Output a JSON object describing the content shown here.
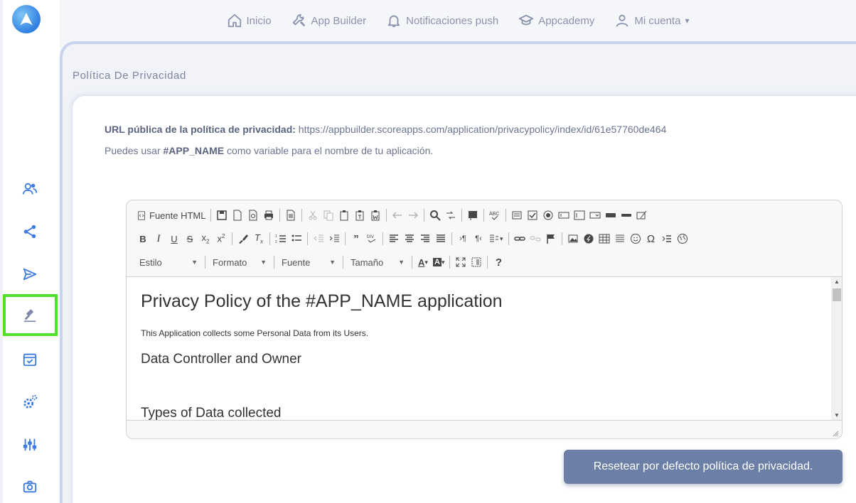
{
  "nav": {
    "items": [
      {
        "label": "Inicio",
        "icon": "home-icon"
      },
      {
        "label": "App Builder",
        "icon": "wrench-icon"
      },
      {
        "label": "Notificaciones push",
        "icon": "bell-icon"
      },
      {
        "label": "Appcademy",
        "icon": "graduation-cap-icon"
      },
      {
        "label": "Mi cuenta",
        "icon": "user-icon"
      }
    ],
    "account_caret": "▾"
  },
  "sidebar": {
    "icons": [
      "users-icon",
      "share-icon",
      "send-icon",
      "gavel-icon",
      "calendar-check-icon",
      "gears-icon",
      "sliders-icon",
      "camera-icon"
    ],
    "active": "gavel-icon"
  },
  "page": {
    "title": "Política De Privacidad",
    "url_label": "URL pública de la política de privacidad:",
    "url_value": " https://appbuilder.scoreapps.com/application/privacypolicy/index/id/61e57760de464",
    "var_prefix": "Puedes usar ",
    "var_name": "#APP_NAME",
    "var_suffix": " como variable para el nombre de tu aplicación."
  },
  "editor": {
    "source_label": "Fuente HTML",
    "combos": {
      "style": "Estilo",
      "format": "Formato",
      "font": "Fuente",
      "size": "Tamaño"
    },
    "content": {
      "h1": "Privacy Policy of the #APP_NAME application",
      "p1": "This Application collects some Personal Data from its Users.",
      "h2a": "Data Controller and Owner",
      "h2b": "Types of Data collected"
    }
  },
  "actions": {
    "reset_label": "Resetear por defecto política de privacidad."
  },
  "colors": {
    "accent": "#6c7fa6",
    "sidebar_icon": "#3d7be0",
    "active_border": "#4ee02c"
  }
}
